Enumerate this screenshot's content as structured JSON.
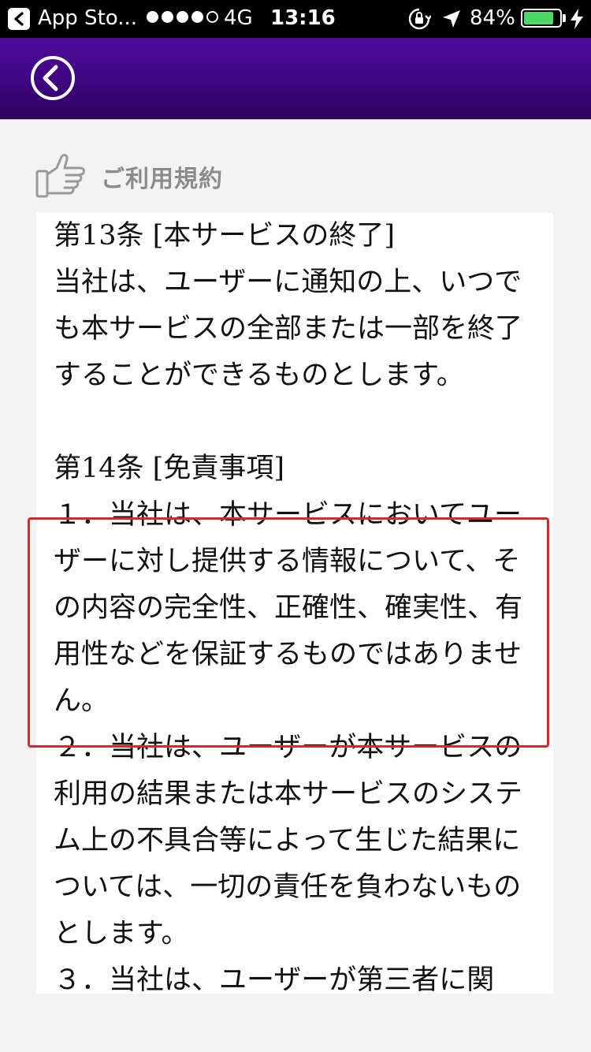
{
  "status_bar": {
    "back_app_label": "App Sto...",
    "network": "4G",
    "time": "13:16",
    "battery_percent": "84%",
    "battery_level": 0.84,
    "signal_bars": 5,
    "signal_active": 4,
    "icons": [
      "back-app-icon",
      "lock-rotation-icon",
      "location-arrow-icon",
      "charging-bolt-icon"
    ]
  },
  "nav": {
    "back_icon": "chevron-left-circle-icon"
  },
  "section": {
    "icon": "thumbs-up-icon",
    "title": "ご利用規約"
  },
  "terms": {
    "article13_title": "第13条 [本サービスの終了]",
    "article13_body": "当社は、ユーザーに通知の上、いつでも本サービスの全部または一部を終了することができるものとします。",
    "article14_title": "第14条 [免責事項]",
    "article14_item1": "１．当社は、本サービスにおいてユーザーに対し提供する情報について、その内容の完全性、正確性、確実性、有用性などを保証するものではありません。",
    "article14_item2": "２．当社は、ユーザーが本サービスの利用の結果または本サービスのシステム上の不具合等によって生じた結果については、一切の責任を負わないものとします。",
    "article14_item3_partial": "３．当社は、ユーザーが第三者に関"
  },
  "colors": {
    "nav_top": "#4e0a9a",
    "nav_bottom": "#2c035c",
    "highlight": "#d42a2a",
    "battery": "#4cd964",
    "section_title": "#8c8c8c"
  }
}
